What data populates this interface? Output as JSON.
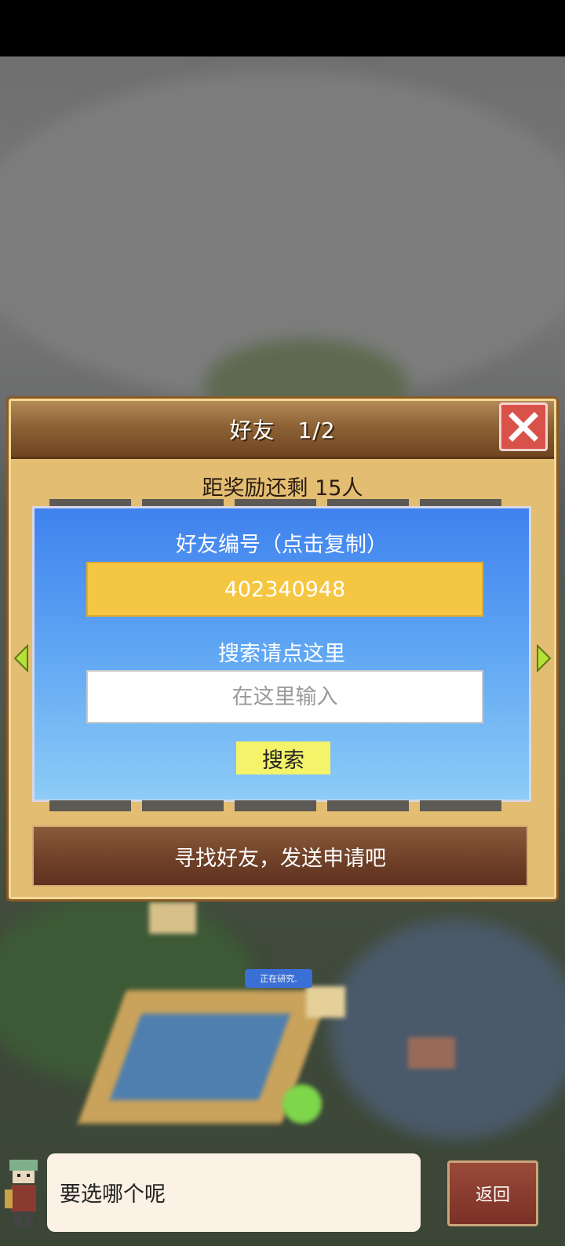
{
  "dialog": {
    "title": "好友　1/2",
    "reward_text": "距奖励还剩 15人",
    "friend_id_label": "好友编号（点击复制）",
    "friend_id": "402340948",
    "search_label": "搜索请点这里",
    "search_placeholder": "在这里输入",
    "search_button": "搜索",
    "find_friends_button": "寻找好友，发送申请吧",
    "close_icon": "close-icon",
    "nav_icons": [
      "arrow-left-icon",
      "arrow-right-icon"
    ]
  },
  "game": {
    "research_badge": "正在研究."
  },
  "bottom_bar": {
    "speech": "要选哪个呢",
    "back_button": "返回"
  },
  "colors": {
    "dialog_bg": "#e3bd72",
    "header_brown": "#8d6236",
    "close_red": "#d9524a",
    "panel_blue": "#3f82ee",
    "id_box_yellow": "#f5c641",
    "search_button_yellow": "#f4f36a",
    "nav_arrow_green": "#b8e03a"
  }
}
